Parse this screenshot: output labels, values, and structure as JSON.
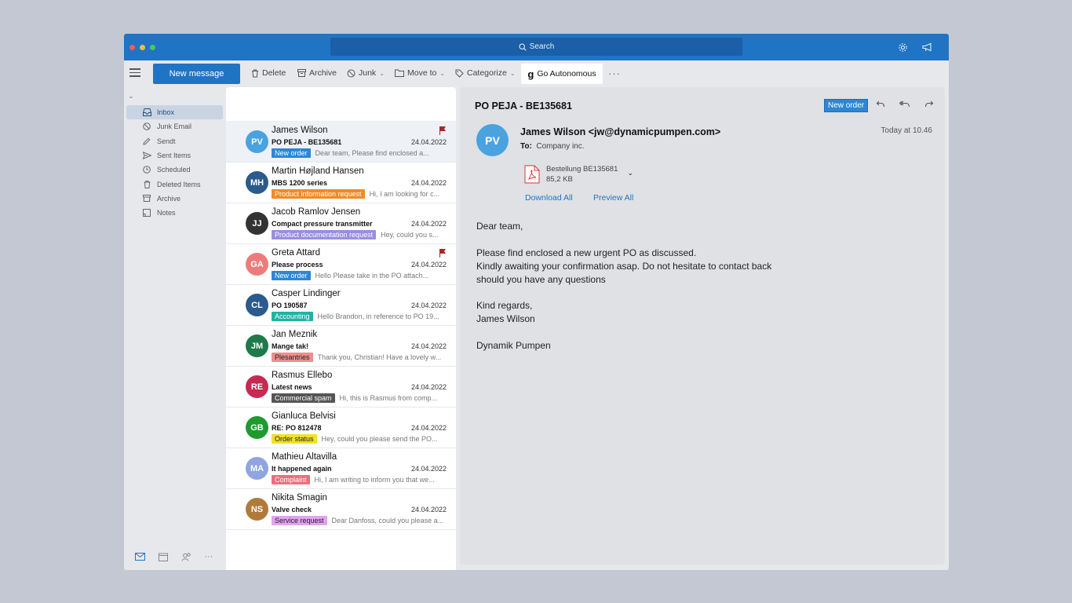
{
  "titlebar": {
    "search_label": "Search",
    "traffic_colors": [
      "#ee5e55",
      "#f4b844",
      "#4cc75a"
    ]
  },
  "toolbar": {
    "new_message": "New message",
    "delete": "Delete",
    "archive": "Archive",
    "junk": "Junk",
    "move_to": "Move to",
    "categorize": "Categorize",
    "go_autonomous": "Go Autonomous",
    "go_autonomous_logo": "g",
    "more": "···"
  },
  "sidebar": {
    "folders": [
      {
        "label": "Inbox",
        "icon": "inbox-icon",
        "active": true
      },
      {
        "label": "Junk Email",
        "icon": "junk-icon"
      },
      {
        "label": "Sendt",
        "icon": "pencil-icon"
      },
      {
        "label": "Sent Items",
        "icon": "send-icon"
      },
      {
        "label": "Scheduled",
        "icon": "clock-icon"
      },
      {
        "label": "Deleted Items",
        "icon": "trash-icon"
      },
      {
        "label": "Archive",
        "icon": "archive-icon"
      },
      {
        "label": "Notes",
        "icon": "notes-icon"
      }
    ],
    "bottom_more": "···"
  },
  "messages": [
    {
      "initials": "PV",
      "avatar_color": "#4aa3df",
      "sender": "James Wilson",
      "subject": "PO PEJA - BE135681",
      "date": "24.04.2022",
      "tag": "New order",
      "tag_bg": "#2e86d4",
      "tag_fg": "#ffffff",
      "preview": "Dear team, Please find enclosed a...",
      "flagged": true,
      "selected": true
    },
    {
      "initials": "MH",
      "avatar_color": "#2b5a8c",
      "sender": "Martin Højland Hansen",
      "subject": "MBS 1200 series",
      "date": "24.04.2022",
      "tag": "Product information request",
      "tag_bg": "#f08a24",
      "tag_fg": "#ffffff",
      "preview": "Hi, I am looking for c...",
      "flagged": false
    },
    {
      "initials": "JJ",
      "avatar_color": "#333333",
      "sender": "Jacob Ramlov Jensen",
      "subject": "Compact pressure transmitter",
      "date": "24.04.2022",
      "tag": "Product documentation request",
      "tag_bg": "#9a8ee0",
      "tag_fg": "#ffffff",
      "preview": "Hey, could you s...",
      "flagged": false
    },
    {
      "initials": "GA",
      "avatar_color": "#ee7b7b",
      "sender": "Greta Attard",
      "subject": "Please process",
      "date": "24.04.2022",
      "tag": "New order",
      "tag_bg": "#2e86d4",
      "tag_fg": "#ffffff",
      "preview": "Hello Please take in the PO attach...",
      "flagged": true
    },
    {
      "initials": "CL",
      "avatar_color": "#2b5a8c",
      "sender": "Casper Lindinger",
      "subject": "PO 190587",
      "date": "24.04.2022",
      "tag": "Accounting",
      "tag_bg": "#1fb3a5",
      "tag_fg": "#ffffff",
      "preview": "Hello Brandon, in reference to PO 19...",
      "flagged": false
    },
    {
      "initials": "JM",
      "avatar_color": "#1f7a4a",
      "sender": "Jan Meznik",
      "subject": "Mange tak!",
      "date": "24.04.2022",
      "tag": "Plesantries",
      "tag_bg": "#ec8f8f",
      "tag_fg": "#222222",
      "preview": "Thank you, Christian! Have a lovely w...",
      "flagged": false
    },
    {
      "initials": "RE",
      "avatar_color": "#c42a52",
      "sender": "Rasmus Ellebo",
      "subject": "Latest news",
      "date": "24.04.2022",
      "tag": "Commercial spam",
      "tag_bg": "#555555",
      "tag_fg": "#ffffff",
      "preview": "Hi, this is Rasmus from comp...",
      "flagged": false
    },
    {
      "initials": "GB",
      "avatar_color": "#1f9a2e",
      "sender": "Gianluca Belvisi",
      "subject": "RE: PO 812478",
      "date": "24.04.2022",
      "tag": "Order status",
      "tag_bg": "#f2e02a",
      "tag_fg": "#222222",
      "preview": "Hey, could you please send the PO...",
      "flagged": false
    },
    {
      "initials": "MA",
      "avatar_color": "#8fa4e0",
      "sender": "Mathieu Altavilla",
      "subject": "It happened again",
      "date": "24.04.2022",
      "tag": "Complaint",
      "tag_bg": "#ee6e7e",
      "tag_fg": "#ffffff",
      "preview": "Hi, I am writing to inform you that we...",
      "flagged": false
    },
    {
      "initials": "NS",
      "avatar_color": "#b07a3a",
      "sender": "Nikita Smagin",
      "subject": "Valve check",
      "date": "24.04.2022",
      "tag": "Service request",
      "tag_bg": "#e3a3f0",
      "tag_fg": "#222222",
      "preview": "Dear Danfoss, could you please a...",
      "flagged": false
    }
  ],
  "reading": {
    "subject": "PO PEJA - BE135681",
    "tag": "New order",
    "initials": "PV",
    "from": "James Wilson <jw@dynamicpumpen.com>",
    "to_label": "To:",
    "to_value": "Company inc.",
    "time": "Today at 10.46",
    "attachment": {
      "name": "Bestellung BE135681",
      "size": "85,2 KB"
    },
    "download_all": "Download All",
    "preview_all": "Preview All",
    "body": [
      "Dear team,",
      "",
      "Please find enclosed a new urgent PO as discussed.",
      "Kindly awaiting your confirmation asap. Do not hesitate to contact back",
      "should you have any questions",
      "",
      "Kind regards,",
      "James Wilson",
      "",
      "Dynamik Pumpen"
    ]
  }
}
